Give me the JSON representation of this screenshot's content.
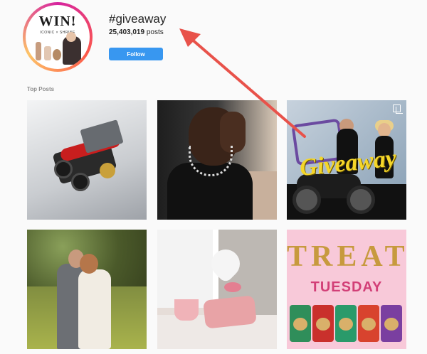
{
  "avatar": {
    "headline": "WIN!",
    "subtext": "ICONIC × SHRINE"
  },
  "header": {
    "hashtag": "#giveaway",
    "post_count": "25,403,019",
    "post_suffix": " posts",
    "follow_label": "Follow"
  },
  "sections": {
    "top_posts_label": "Top Posts"
  },
  "tiles": [
    {
      "name": "post-engine-model"
    },
    {
      "name": "post-man-chain"
    },
    {
      "name": "post-giveaway-bikers",
      "overlay_text": "Giveaway"
    },
    {
      "name": "post-wedding-couple"
    },
    {
      "name": "post-valentine-decor"
    },
    {
      "name": "post-treat-tuesday",
      "headline": "TREAT",
      "subheadline": "TUESDAY"
    }
  ],
  "colors": {
    "follow_button": "#3897f0",
    "annotation_arrow": "#e8524a",
    "treat_gold": "#c79a3e",
    "tuesday_pink": "#d23f77"
  },
  "icons": {
    "multi_post": "multiple-posts-icon"
  }
}
